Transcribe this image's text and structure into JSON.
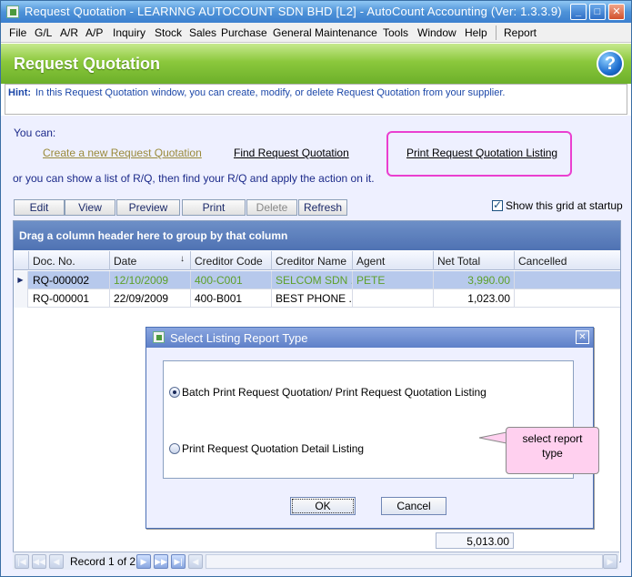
{
  "window": {
    "title": "Request Quotation - LEARNNG AUTOCOUNT SDN BHD [L2] - AutoCount Accounting (Ver: 1.3.3.9)",
    "min": "_",
    "max": "□",
    "close": "✕"
  },
  "menu": {
    "items": [
      "File",
      "G/L",
      "A/R",
      "A/P",
      "Inquiry",
      "Stock",
      "Sales",
      "Purchase",
      "General Maintenance",
      "Tools",
      "Window",
      "Help",
      "Report"
    ]
  },
  "header": {
    "title": "Request Quotation",
    "help": "?"
  },
  "hint": {
    "label": "Hint:",
    "text": "In this Request Quotation window, you can create, modify, or delete Request Quotation from your supplier."
  },
  "actions": {
    "you_can": "You can:",
    "create": "Create a new Request Quotation",
    "find": "Find Request Quotation",
    "print": "Print Request Quotation Listing",
    "or_text": "or you can show a  list of R/Q, then find your R/Q and apply the action on it."
  },
  "toolbar": {
    "edit": "Edit",
    "view": "View",
    "preview": "Preview",
    "print": "Print",
    "delete": "Delete",
    "refresh": "Refresh",
    "show_grid": "Show this grid at startup"
  },
  "grid": {
    "group_hint": "Drag a column header here to group by that column",
    "columns": [
      "Doc. No.",
      "Date",
      "Creditor Code",
      "Creditor Name",
      "Agent",
      "Net Total",
      "Cancelled"
    ],
    "sort_arrow": "↓",
    "rows": [
      {
        "doc": "RQ-000002",
        "date": "12/10/2009",
        "code": "400-C001",
        "name": "SELCOM SDN ...",
        "agent": "PETE",
        "total": "3,990.00",
        "cancelled": ""
      },
      {
        "doc": "RQ-000001",
        "date": "22/09/2009",
        "code": "400-B001",
        "name": "BEST PHONE ...",
        "agent": "",
        "total": "1,023.00",
        "cancelled": ""
      }
    ],
    "footer_total": "5,013.00",
    "record_text": "Record 1 of 2"
  },
  "dialog": {
    "title": "Select Listing Report Type",
    "close": "✕",
    "option1": "Batch Print Request Quotation/ Print Request Quotation Listing",
    "option2": "Print Request Quotation Detail Listing",
    "ok": "OK",
    "cancel": "Cancel"
  },
  "callout": {
    "text": "select report type"
  }
}
